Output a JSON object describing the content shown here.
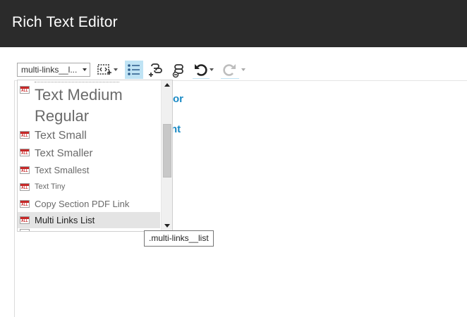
{
  "header": {
    "title": "Rich Text Editor"
  },
  "toolbar": {
    "style_select_value": "multi-links__l...",
    "buttons": [
      {
        "icon": "insert-snippet-icon"
      },
      {
        "icon": "bulleted-list-icon",
        "active": true
      },
      {
        "icon": "insert-link-icon"
      },
      {
        "icon": "remove-link-icon"
      },
      {
        "icon": "undo-icon"
      },
      {
        "icon": "redo-icon"
      }
    ]
  },
  "content": {
    "line1_fragment": "tor",
    "line2_fragment": "nt"
  },
  "dropdown": {
    "items": [
      {
        "label": "Text Medium"
      },
      {
        "label": "Regular"
      },
      {
        "label": "Text Small"
      },
      {
        "label": "Text Smaller"
      },
      {
        "label": "Text Smallest"
      },
      {
        "label": "Text Tiny"
      },
      {
        "label": "Copy Section PDF Link"
      },
      {
        "label": "Multi Links List",
        "selected": true
      }
    ]
  },
  "tooltip": {
    "text": ".multi-links__list"
  },
  "colors": {
    "header_bg": "#2b2b2b",
    "accent": "#1a8ac5",
    "active_button": "#bfe3f4"
  }
}
